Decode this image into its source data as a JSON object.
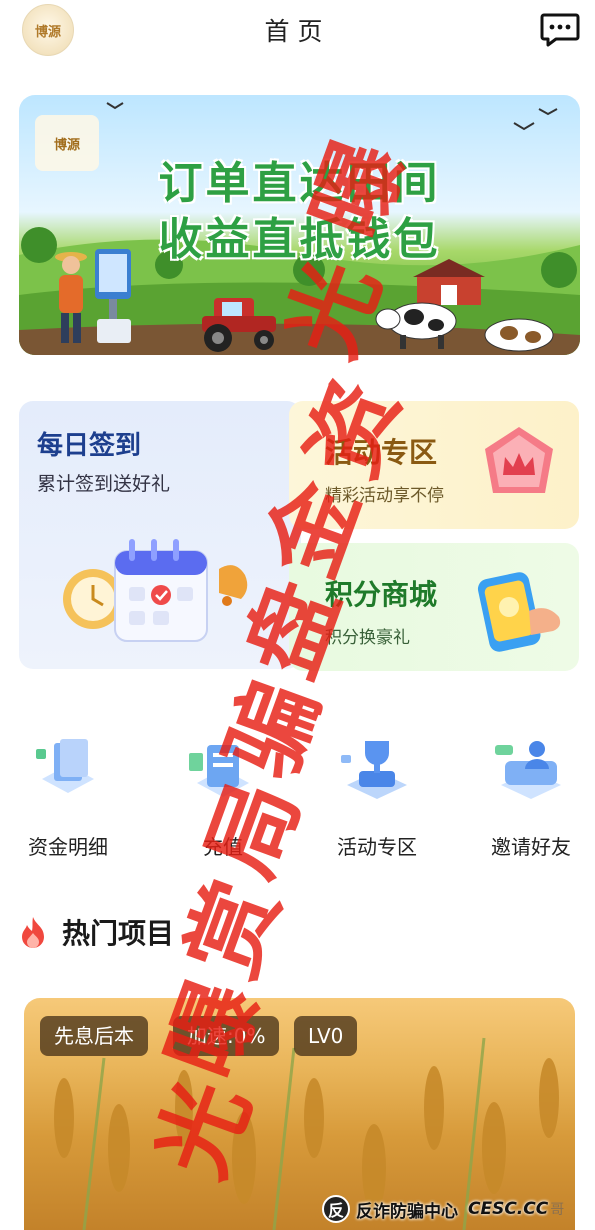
{
  "header": {
    "logo_text": "博源",
    "title": "首页",
    "message_icon": "chat-bubble-icon"
  },
  "banner": {
    "logo_text": "博源",
    "line1": "订单直达田间",
    "line2": "收益直抵钱包"
  },
  "cards": {
    "signin": {
      "title": "每日签到",
      "subtitle": "累计签到送好礼",
      "icon": "calendar-alarm-icon"
    },
    "activity": {
      "title": "活动专区",
      "subtitle": "精彩活动享不停",
      "icon": "crown-badge-icon"
    },
    "mall": {
      "title": "积分商城",
      "subtitle": "积分换豪礼",
      "icon": "phone-gift-icon"
    }
  },
  "quick_links": [
    {
      "label": "资金明细",
      "icon": "fund-details-icon"
    },
    {
      "label": "充值",
      "icon": "recharge-icon"
    },
    {
      "label": "活动专区",
      "icon": "trophy-icon"
    },
    {
      "label": "邀请好友",
      "icon": "invite-friends-icon"
    }
  ],
  "section": {
    "title": "热门项目",
    "icon": "fire-icon"
  },
  "project": {
    "tags": [
      "先息后本",
      "加速:0%",
      "LV0"
    ]
  },
  "overlay_stamp": [
    "曝",
    "光",
    "资",
    "金",
    "盘",
    "骗",
    "局",
    "赏",
    "曝",
    "光"
  ],
  "footer_mark": {
    "logo": "反",
    "text": "反诈防骗中心",
    "site": "CESC.CC",
    "tail": "哥"
  },
  "colors": {
    "banner_green": "#2ea043",
    "signin_title": "#1d3f8e",
    "activity_title": "#8a5a12",
    "mall_title": "#1f7a2a",
    "stamp_red": "#e61e14"
  }
}
